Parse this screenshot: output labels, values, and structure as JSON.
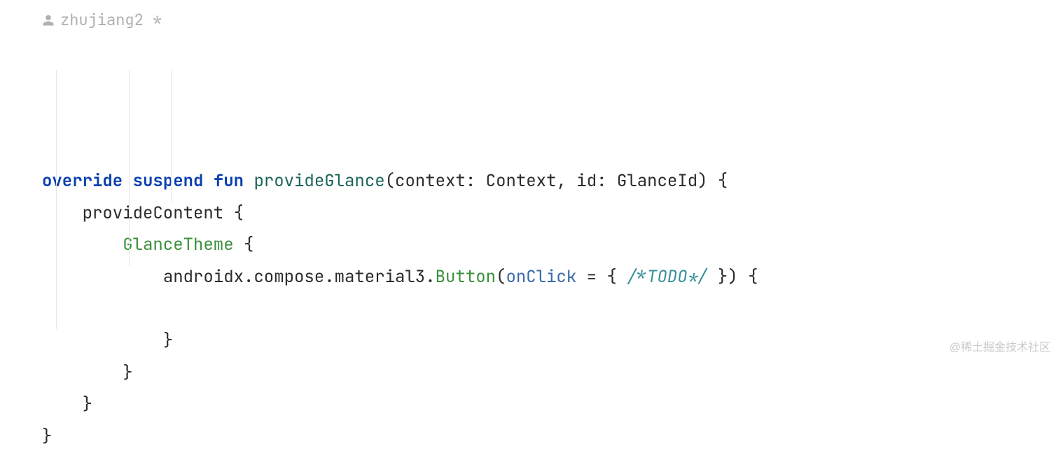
{
  "author": {
    "name": "zhujiang2",
    "dirty": "*"
  },
  "tokens": {
    "kw_override": "override",
    "kw_suspend": "suspend",
    "kw_fun": "fun",
    "fn_name": "provideGlance",
    "sig_open": "(",
    "p1_name": "context",
    "colon1": ": ",
    "p1_type": "Context",
    "sep": ", ",
    "p2_name": "id",
    "colon2": ": ",
    "p2_type": "GlanceId",
    "sig_close": ")",
    "brace_open": " {",
    "provideContent": "provideContent",
    "brace_open2": " {",
    "glanceTheme": "GlanceTheme",
    "brace_open3": " {",
    "pkg": "androidx.compose.material3.",
    "button": "Button",
    "paren_open": "(",
    "onClick": "onClick",
    "eq": " = { ",
    "todo": "/*TODO*/",
    "lambda_close": " }",
    "paren_close": ")",
    "brace_open4": " {",
    "brace_close4": "}",
    "brace_close3": "}",
    "brace_close2": "}",
    "brace_close1": "}"
  },
  "watermark": "@稀土掘金技术社区"
}
